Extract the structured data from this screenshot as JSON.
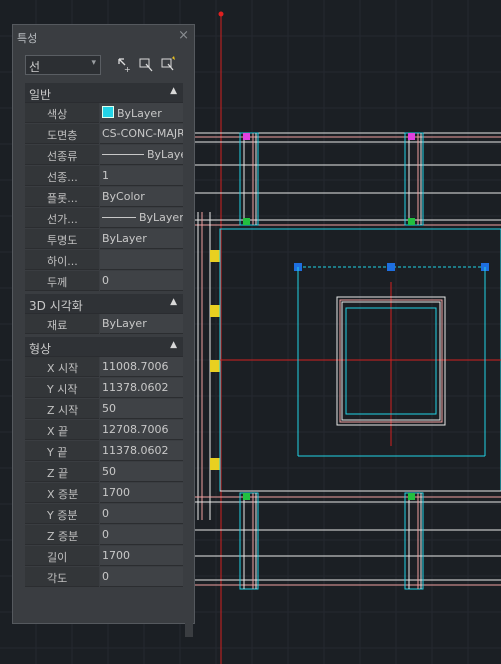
{
  "palette": {
    "title": "특성",
    "close_glyph": "×",
    "selected_object": "선",
    "dropdown_glyph": "▾",
    "toolbar_icons": [
      "toggle-pickadd-icon",
      "select-objects-icon",
      "quick-select-icon"
    ],
    "collapse_glyph": "▲"
  },
  "sections": {
    "general": {
      "title": "일반",
      "rows": [
        {
          "label": "색상",
          "value": "ByLayer"
        },
        {
          "label": "도면층",
          "value": "CS-CONC-MAJR"
        },
        {
          "label": "선종류",
          "value": "ByLayer"
        },
        {
          "label": "선종...",
          "value": "1"
        },
        {
          "label": "플롯...",
          "value": "ByColor"
        },
        {
          "label": "선가...",
          "value": "ByLayer"
        },
        {
          "label": "투명도",
          "value": "ByLayer"
        },
        {
          "label": "하이...",
          "value": ""
        },
        {
          "label": "두께",
          "value": "0"
        }
      ]
    },
    "visualization": {
      "title": "3D 시각화",
      "rows": [
        {
          "label": "재료",
          "value": "ByLayer"
        }
      ]
    },
    "geometry": {
      "title": "형상",
      "rows": [
        {
          "label": "X 시작",
          "value": "11008.7006"
        },
        {
          "label": "Y 시작",
          "value": "11378.0602"
        },
        {
          "label": "Z 시작",
          "value": "50"
        },
        {
          "label": "X 끝",
          "value": "12708.7006"
        },
        {
          "label": "Y 끝",
          "value": "11378.0602"
        },
        {
          "label": "Z 끝",
          "value": "50"
        },
        {
          "label": "X 증분",
          "value": "1700"
        },
        {
          "label": "Y 증분",
          "value": "0"
        },
        {
          "label": "Z 증분",
          "value": "0"
        },
        {
          "label": "길이",
          "value": "1700"
        },
        {
          "label": "각도",
          "value": "0"
        }
      ]
    }
  },
  "colors": {
    "background": "#1b1f24",
    "color_swatch": "#22d3e6",
    "grip": "#1e6fe0",
    "selected_line": "#22d3e6"
  }
}
